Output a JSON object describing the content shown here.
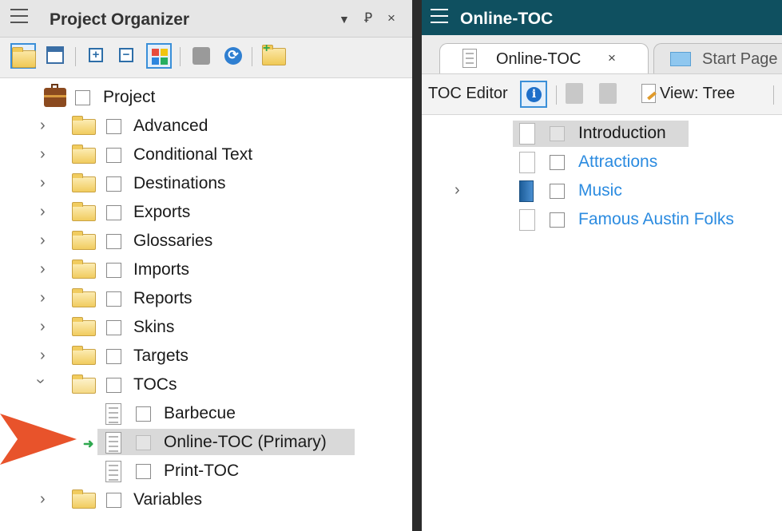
{
  "left_panel": {
    "title": "Project Organizer",
    "controls": {
      "dropdown": "▼",
      "pin": "Ꝑ",
      "close": "×"
    },
    "tree": {
      "root": "Project",
      "folders": [
        "Advanced",
        "Conditional Text",
        "Destinations",
        "Exports",
        "Glossaries",
        "Imports",
        "Reports",
        "Skins",
        "Targets",
        "TOCs"
      ],
      "tocs": [
        "Barbecue",
        "Online-TOC (Primary)",
        "Print-TOC"
      ],
      "last_folder": "Variables"
    }
  },
  "right_panel": {
    "title": "Online-TOC",
    "tabs": [
      {
        "label": "Online-TOC",
        "close": "×",
        "active": true
      },
      {
        "label": "Start Page",
        "active": false
      }
    ],
    "toolbar": {
      "label": "TOC Editor",
      "view": "View: Tree"
    },
    "toc_items": [
      {
        "label": "Introduction",
        "type": "topic",
        "selected": true
      },
      {
        "label": "Attractions",
        "type": "topic",
        "link": true
      },
      {
        "label": "Music",
        "type": "book",
        "link": true,
        "expandable": true
      },
      {
        "label": "Famous Austin Folks",
        "type": "topic",
        "link": true
      }
    ]
  },
  "colors": {
    "accent": "#3a8fd8",
    "title_bar_dark": "#0f5060",
    "link": "#2b8be0",
    "pointer_arrow": "#e8532b",
    "selection": "#d9d9d9"
  }
}
